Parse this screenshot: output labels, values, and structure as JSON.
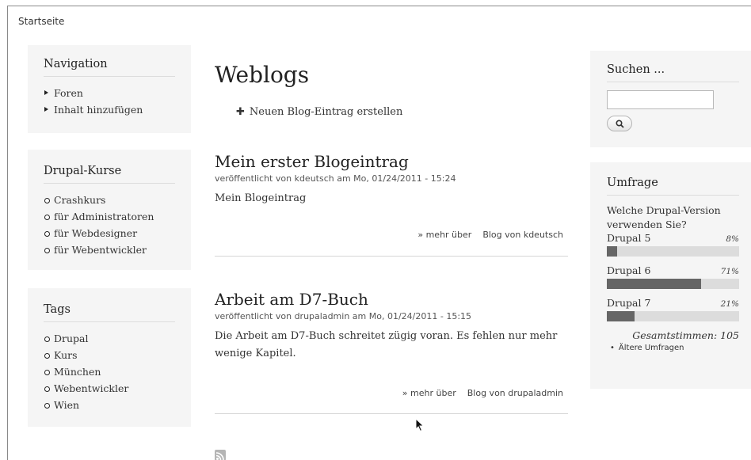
{
  "breadcrumb": "Startseite",
  "navigation": {
    "title": "Navigation",
    "items": [
      "Foren",
      "Inhalt hinzufügen"
    ]
  },
  "kurse": {
    "title": "Drupal-Kurse",
    "items": [
      "Crashkurs",
      "für Administratoren",
      "für Webdesigner",
      "für Webentwickler"
    ]
  },
  "tags": {
    "title": "Tags",
    "items": [
      "Drupal",
      "Kurs",
      "München",
      "Webentwickler",
      "Wien"
    ]
  },
  "main": {
    "title": "Weblogs",
    "add_link": "Neuen Blog-Eintrag erstellen",
    "posts": [
      {
        "title": "Mein erster Blogeintrag",
        "meta": "veröffentlicht von kdeutsch am Mo, 01/24/2011 - 15:24",
        "body": "Mein Blogeintrag",
        "more": "» mehr über",
        "blog_link": "Blog von kdeutsch"
      },
      {
        "title": "Arbeit am D7-Buch",
        "meta": "veröffentlicht von drupaladmin am Mo, 01/24/2011 - 15:15",
        "body": "Die Arbeit am D7-Buch schreitet zügig voran. Es fehlen nur mehr wenige Kapitel.",
        "more": "» mehr über",
        "blog_link": "Blog von drupaladmin"
      }
    ],
    "feed_icon": "rss-feed-icon"
  },
  "search": {
    "title": "Suchen ...",
    "value": "",
    "button_icon": "magnifier-icon"
  },
  "poll": {
    "title": "Umfrage",
    "question": "Welche Drupal-Version verwenden Sie?",
    "choices": [
      {
        "label": "Drupal 5",
        "percent": 8,
        "percent_label": "8%"
      },
      {
        "label": "Drupal 6",
        "percent": 71,
        "percent_label": "71%"
      },
      {
        "label": "Drupal 7",
        "percent": 21,
        "percent_label": "21%"
      }
    ],
    "total": "Gesamtstimmen: 105",
    "older": "Ältere Umfragen"
  }
}
